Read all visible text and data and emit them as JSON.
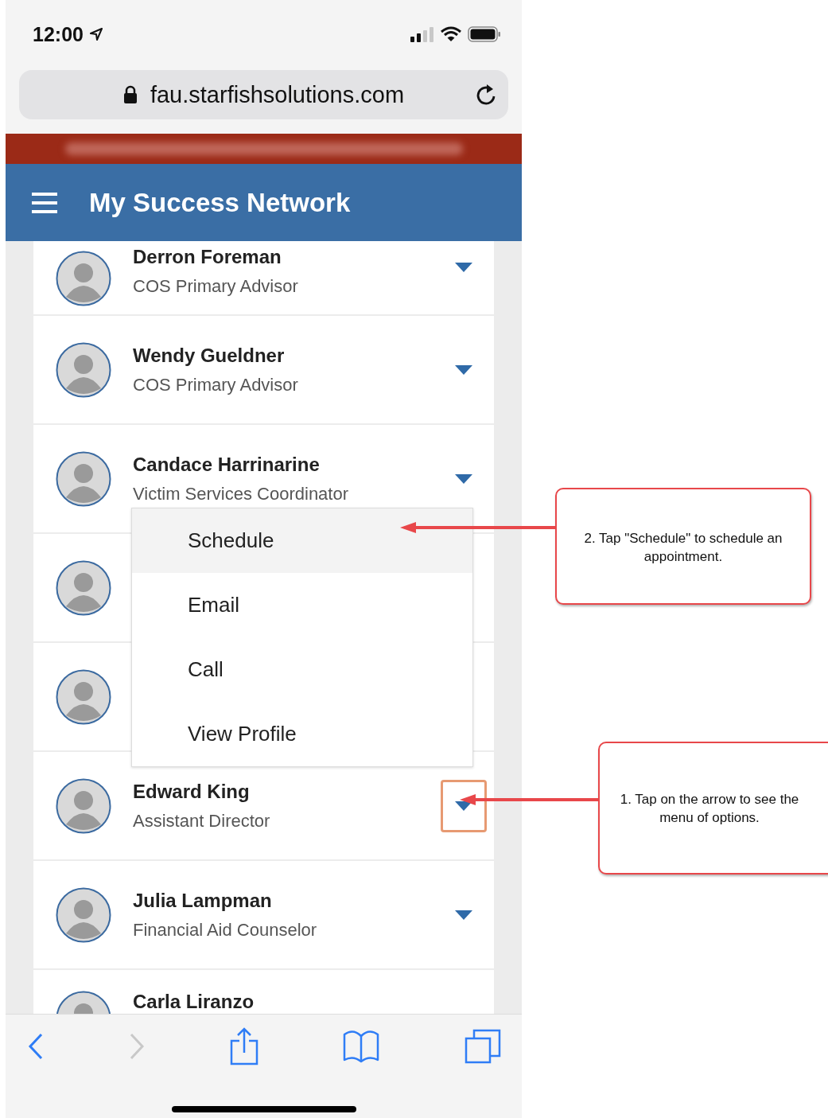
{
  "status_bar": {
    "time": "12:00"
  },
  "address_bar": {
    "url": "fau.starfishsolutions.com"
  },
  "header": {
    "title": "My Success Network"
  },
  "people": [
    {
      "kind": "advisor",
      "name": "Derron Foreman",
      "role": "COS Primary Advisor",
      "highlighted": false
    },
    {
      "kind": "advisor",
      "name": "Wendy Gueldner",
      "role": "COS Primary Advisor",
      "highlighted": false
    },
    {
      "kind": "advisor",
      "name": "Candace Harrinarine",
      "role": "Victim Services Coordinator",
      "highlighted": false,
      "menu": [
        {
          "label": "Schedule",
          "selected": true
        },
        {
          "label": "Email",
          "selected": false
        },
        {
          "label": "Call",
          "selected": false
        },
        {
          "label": "View Profile",
          "selected": false
        }
      ]
    },
    {
      "kind": "covered"
    },
    {
      "kind": "covered"
    },
    {
      "kind": "advisor",
      "name": "Edward King",
      "role": "Assistant Director",
      "highlighted": true
    },
    {
      "kind": "advisor",
      "name": "Julia Lampman",
      "role": "Financial Aid Counselor",
      "highlighted": false
    },
    {
      "kind": "cut",
      "name": "Carla Liranzo"
    }
  ],
  "toolbar": [
    {
      "kind": "back",
      "disabled": false
    },
    {
      "kind": "forward",
      "disabled": true
    },
    {
      "kind": "share",
      "disabled": false
    },
    {
      "kind": "bookmarks",
      "disabled": false
    },
    {
      "kind": "tabs",
      "disabled": false
    }
  ],
  "annotations": [
    {
      "text": "2. Tap \"Schedule\" to schedule an appointment."
    },
    {
      "text": "1. Tap on the arrow to see the menu of options."
    }
  ]
}
